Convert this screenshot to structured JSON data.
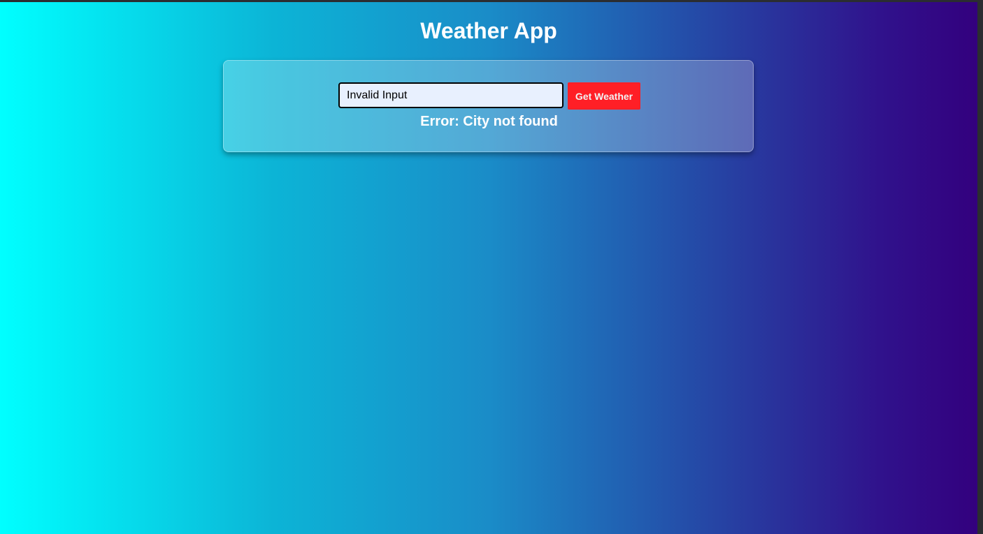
{
  "app": {
    "title": "Weather App"
  },
  "search": {
    "value": "Invalid Input",
    "button_label": "Get Weather"
  },
  "status": {
    "error_message": "Error: City not found"
  },
  "colors": {
    "background_gradient_start": "#00ffff",
    "background_gradient_end": "#33007e",
    "button": "#ff1f26",
    "input_background": "#e8f0fe"
  }
}
